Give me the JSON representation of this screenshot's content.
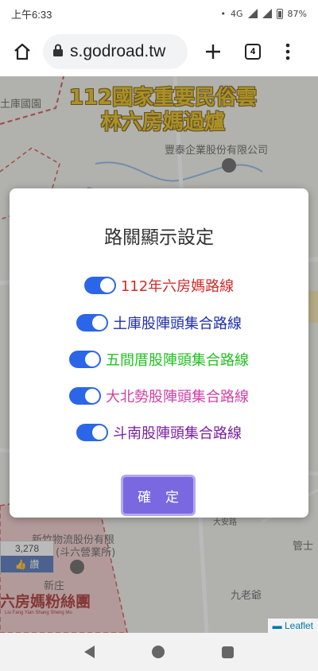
{
  "status_bar": {
    "time": "上午6:33",
    "network": "4G",
    "battery": "87%"
  },
  "browser": {
    "url": "s.godroad.tw",
    "tab_count": "4"
  },
  "map": {
    "title_line1": "112國家重要民俗雲",
    "title_line2": "林六房媽過爐",
    "poi_top_left": "土庫國園",
    "poi_company": "豐泰企業股份有限公司",
    "poi_logistics_1": "新竹物流股份有限",
    "poi_logistics_2": "(斗六營業所)",
    "poi_xinzhuang": "新庄",
    "poi_jiulaoye": "九老爺",
    "poi_road": "大安路",
    "poi_guantu": "管士",
    "like_count": "3,278",
    "like_label": "讚",
    "brand_text": "六房媽粉絲團",
    "brand_sub": "Liu Fang Yian Shang Sheng Mu",
    "attribution": "Leaflet"
  },
  "dialog": {
    "title": "路關顯示設定",
    "routes": [
      {
        "label": "112年六房媽路線",
        "color": "#d42a2a",
        "enabled": true
      },
      {
        "label": "土庫股陣頭集合路線",
        "color": "#1f2fa8",
        "enabled": true
      },
      {
        "label": "五間厝股陣頭集合路線",
        "color": "#22c022",
        "enabled": true
      },
      {
        "label": "大北勢股陣頭集合路線",
        "color": "#d23fa8",
        "enabled": true
      },
      {
        "label": "斗南股陣頭集合路線",
        "color": "#7a1fa0",
        "enabled": true
      }
    ],
    "confirm_label": "確定"
  },
  "colors": {
    "toggle_on": "#2b66e8",
    "confirm_button": "#7a68e0"
  }
}
